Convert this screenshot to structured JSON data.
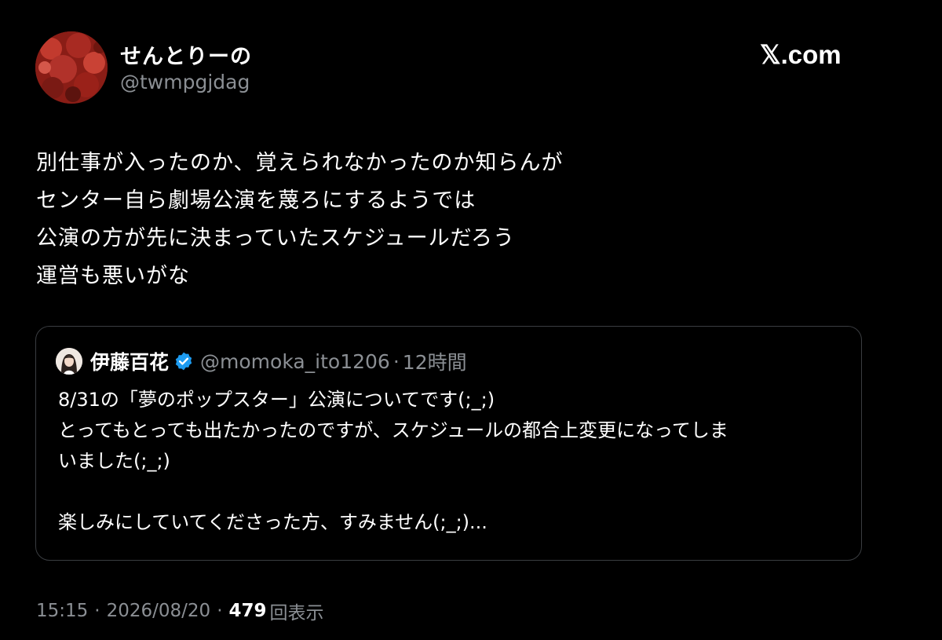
{
  "author": {
    "display_name": "せんとりーの",
    "handle": "@twmpgjdag"
  },
  "brand": {
    "label": "𝕏.com"
  },
  "tweet": {
    "lines": [
      "別仕事が入ったのか、覚えられなかったのか知らんが",
      "センター自ら劇場公演を蔑ろにするようでは",
      "公演の方が先に決まっていたスケジュールだろう",
      "運営も悪いがな"
    ]
  },
  "quote": {
    "name": "伊藤百花",
    "handle": "@momoka_ito1206",
    "separator": "·",
    "time": "12時間",
    "verified_color": "#1d9bf0",
    "lines": [
      "8/31の「夢のポップスター」公演についてです(;_;)",
      "とってもとっても出たかったのですが、スケジュールの都合上変更になってしま",
      "いました(;_;)",
      "",
      "楽しみにしていてくださった方、すみません(;_;)..."
    ]
  },
  "meta": {
    "time": "15:15",
    "separator": "·",
    "date": "2026/08/20",
    "views_count": "479",
    "views_label": "回表示"
  },
  "icons": {
    "verified": "verified-badge-icon"
  }
}
